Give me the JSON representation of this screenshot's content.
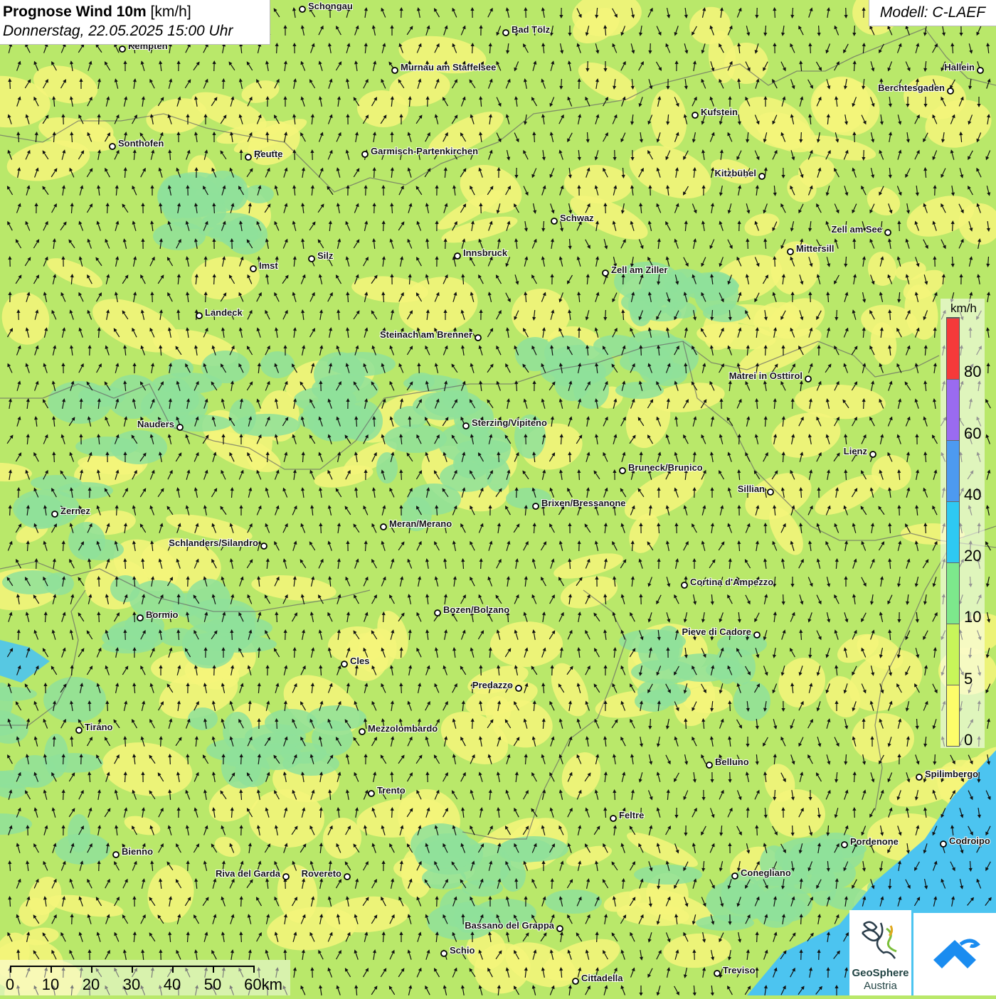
{
  "title": {
    "bold": "Prognose Wind 10m",
    "unit": " [km/h]",
    "date": "Donnerstag, 22.05.2025 15:00 Uhr"
  },
  "model": "Modell: C-LAEF",
  "legend": {
    "unit": "km/h",
    "labels": [
      "0",
      "5",
      "10",
      "20",
      "40",
      "60",
      "80"
    ],
    "colors": [
      "#fdfd6a",
      "#c8f55a",
      "#7de88c",
      "#2ec9f2",
      "#4d9af0",
      "#9a6bf0",
      "#f53a3a"
    ]
  },
  "scale": {
    "labels": [
      "0",
      "10",
      "20",
      "30",
      "40",
      "50",
      "60km"
    ]
  },
  "logos": {
    "geosphere_line1": "GeoSphere",
    "geosphere_line2": "Austria",
    "geosphere_icon": "geosphere-swirl-icon",
    "app_icon": "wind-app-icon"
  },
  "background_colors": {
    "base": "#b9e86a",
    "calm": "#f4f57a",
    "breeze": "#8fe09a",
    "strong": "#4cc4f0"
  },
  "cities": [
    {
      "name": "Schongau"
    },
    {
      "name": "Bad Tölz"
    },
    {
      "name": "Kempten"
    },
    {
      "name": "Murnau am Staffelsee"
    },
    {
      "name": "Hallein"
    },
    {
      "name": "Berchtesgaden"
    },
    {
      "name": "Kufstein"
    },
    {
      "name": "Sonthofen"
    },
    {
      "name": "Reutte"
    },
    {
      "name": "Garmisch-Partenkirchen"
    },
    {
      "name": "Kitzbühel"
    },
    {
      "name": "Schwaz"
    },
    {
      "name": "Zell am See"
    },
    {
      "name": "Mittersill"
    },
    {
      "name": "Silz"
    },
    {
      "name": "Innsbruck"
    },
    {
      "name": "Imst"
    },
    {
      "name": "Zell am Ziller"
    },
    {
      "name": "Landeck"
    },
    {
      "name": "Steinach am Brenner"
    },
    {
      "name": "Matrei in Osttirol"
    },
    {
      "name": "Nauders"
    },
    {
      "name": "Sterzing/Vipiteno"
    },
    {
      "name": "Lienz"
    },
    {
      "name": "Bruneck/Brunico"
    },
    {
      "name": "Sillian"
    },
    {
      "name": "Zernez"
    },
    {
      "name": "Brixen/Bressanone"
    },
    {
      "name": "Meran/Merano"
    },
    {
      "name": "Schlanders/Silandro"
    },
    {
      "name": "Cortina d'Ampezzo"
    },
    {
      "name": "Bozen/Bolzano"
    },
    {
      "name": "Bormio"
    },
    {
      "name": "Pieve di Cadore"
    },
    {
      "name": "Cles"
    },
    {
      "name": "Predazzo"
    },
    {
      "name": "Tirano"
    },
    {
      "name": "Mezzolombardo"
    },
    {
      "name": "Belluno"
    },
    {
      "name": "Spilimbergo"
    },
    {
      "name": "Trento"
    },
    {
      "name": "Feltre"
    },
    {
      "name": "Pordenone"
    },
    {
      "name": "Codroipo"
    },
    {
      "name": "Bienno"
    },
    {
      "name": "Riva del Garda"
    },
    {
      "name": "Rovereto"
    },
    {
      "name": "Conegliano"
    },
    {
      "name": "Bassano del Grappa"
    },
    {
      "name": "Schio"
    },
    {
      "name": "Treviso"
    },
    {
      "name": "Cittadella"
    }
  ]
}
